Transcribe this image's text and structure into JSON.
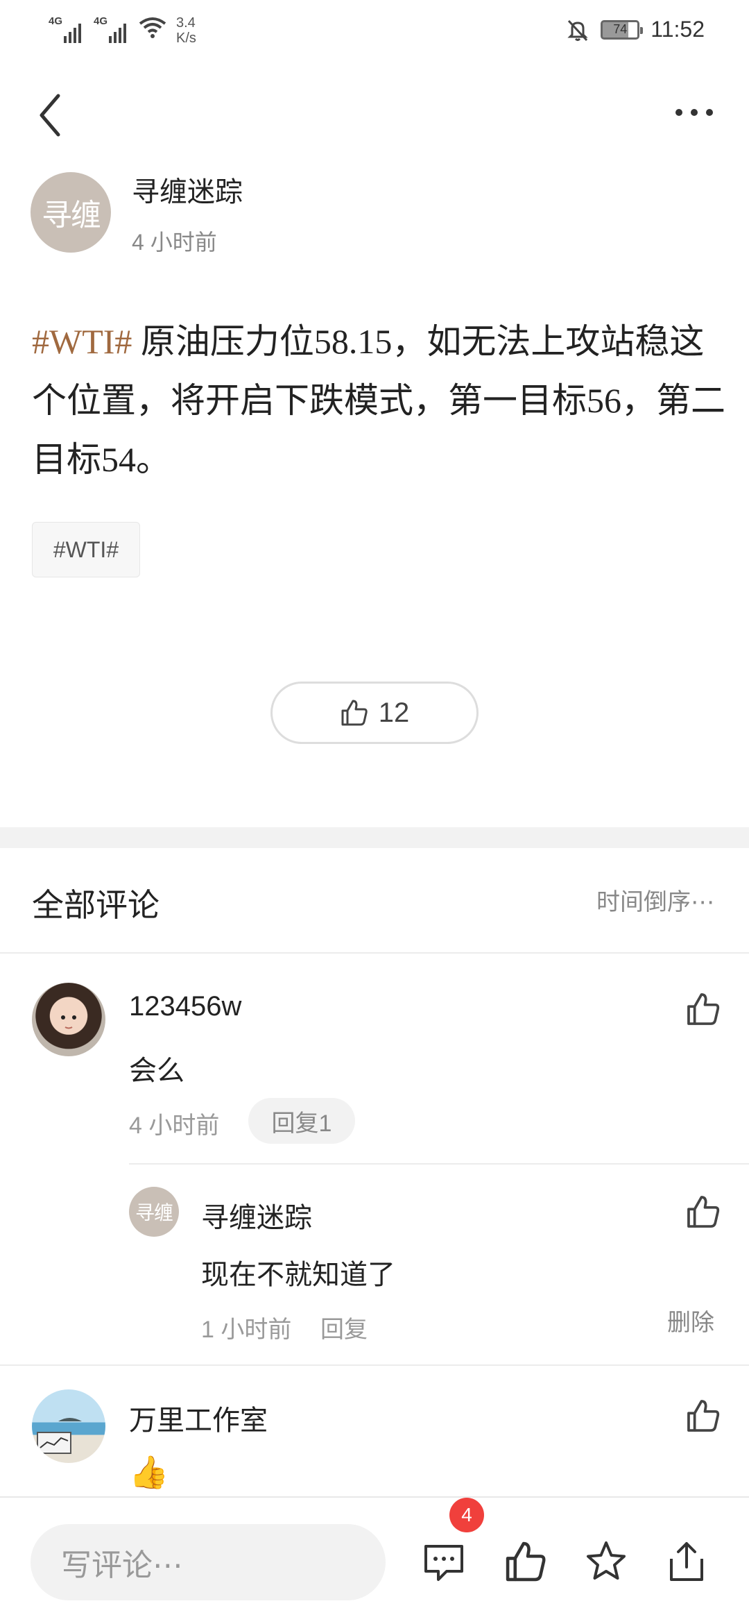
{
  "status_bar": {
    "network_1": "4G",
    "network_2": "4G",
    "speed_value": "3.4",
    "speed_unit": "K/s",
    "battery": "74",
    "time": "11:52"
  },
  "post": {
    "author_avatar_text": "寻缠",
    "author_name": "寻缠迷踪",
    "time": "4 小时前",
    "topic": "#WTI#",
    "body": " 原油压力位58.15，如无法上攻站稳这个位置，将开启下跌模式，第一目标56，第二目标54。",
    "tag_chip": "#WTI#",
    "like_count": "12"
  },
  "comments_section": {
    "title": "全部评论",
    "sort_label": "时间倒序⋯"
  },
  "comments": [
    {
      "name": "123456w",
      "text": "会么",
      "time": "4 小时前",
      "reply_label": "回复1",
      "replies": [
        {
          "avatar_text": "寻缠",
          "name": "寻缠迷踪",
          "text": "现在不就知道了",
          "time": "1 小时前",
          "reply_label": "回复",
          "delete_label": "删除"
        }
      ]
    },
    {
      "name": "万里工作室",
      "text": "👍"
    }
  ],
  "bottom_bar": {
    "input_placeholder": "写评论⋯",
    "comment_badge": "4"
  },
  "colors": {
    "topic": "#a0693f",
    "badge": "#f0403c",
    "avatar_bg": "#c9bfb6"
  }
}
